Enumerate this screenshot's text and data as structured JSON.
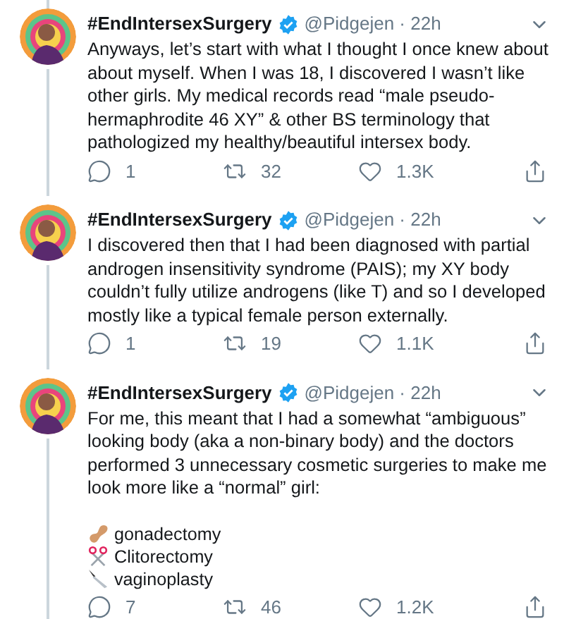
{
  "tweets": [
    {
      "name": "#EndIntersexSurgery",
      "verified": true,
      "meta": "@Pidgejen · 22h",
      "text": "Anyways, let’s start with what I thought I once knew about about myself. When I was 18, I discovered I wasn’t like other girls. My medical records read “male pseudo-hermaphrodite 46 XY” & other BS terminology that pathologized my healthy/beautiful intersex body.",
      "replies": "1",
      "retweets": "32",
      "likes": "1.3K"
    },
    {
      "name": "#EndIntersexSurgery",
      "verified": true,
      "meta": "@Pidgejen · 22h",
      "text": "I discovered then that I had been diagnosed with partial androgen insensitivity syndrome (PAIS); my XY body couldn’t fully utilize androgens (like T) and so I developed mostly like a typical female person externally.",
      "replies": "1",
      "retweets": "19",
      "likes": "1.1K"
    },
    {
      "name": "#EndIntersexSurgery",
      "verified": true,
      "meta": "@Pidgejen · 22h",
      "text": "For me, this meant that I had a somewhat “ambiguous” looking body (aka a non-binary body) and the doctors performed 3 unnecessary cosmetic surgeries to make me look more like a “normal” girl:",
      "list": [
        {
          "kind": "peanut",
          "label": "gonadectomy"
        },
        {
          "kind": "scissors",
          "label": "Clitorectomy"
        },
        {
          "kind": "knife",
          "label": "vaginoplasty"
        }
      ],
      "replies": "7",
      "retweets": "46",
      "likes": "1.2K"
    }
  ]
}
